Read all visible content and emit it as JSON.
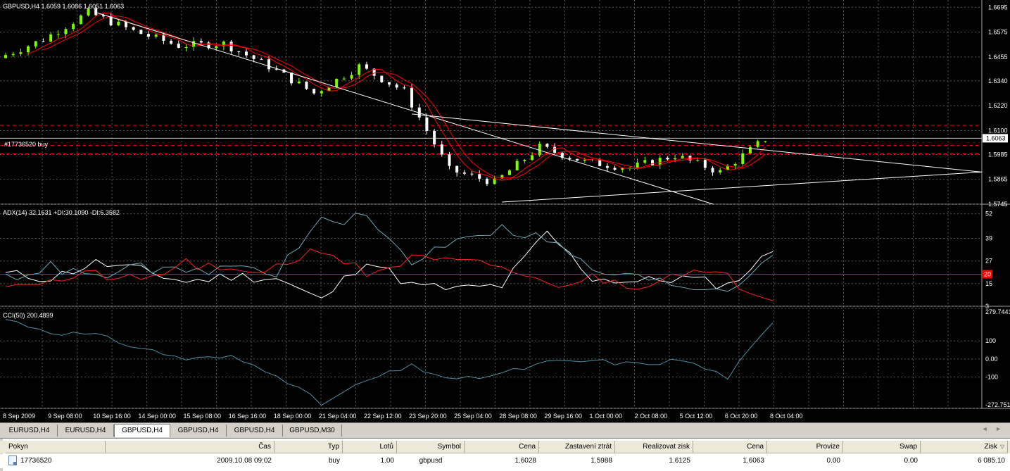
{
  "colors": {
    "background": "#000000",
    "grid": "#5a5a5a",
    "bull_candle": "#7cfc00",
    "bear_candle": "#ffffff",
    "ma": "#ff0000",
    "trendline": "#ffffff",
    "level_line": "#ff0000",
    "price_line": "#c0c0c0",
    "adx_main": "#ffffff",
    "adx_plus_di": "#6fa8b4",
    "adx_minus_di": "#ff2020",
    "cci": "#4f8ea0"
  },
  "main_panel": {
    "header": "GBPUSD,H4  1.6059 1.6086 1.6051 1.6063",
    "order_label": "#17736520 buy",
    "current_price": "1.6063",
    "price_axis": [
      "1.6695",
      "1.6575",
      "1.6455",
      "1.6340",
      "1.6220",
      "1.6100",
      "1.5985",
      "1.5865",
      "1.5745"
    ]
  },
  "adx_panel": {
    "header": "ADX(14) 32.1631 +DI:30.1090 -DI:6.3582",
    "axis": [
      "52",
      "39",
      "27",
      "15",
      "3"
    ],
    "level_marker": "20"
  },
  "cci_panel": {
    "header": "CCI(50) 200.4899",
    "axis": [
      "279.7441",
      "100",
      "0.00",
      "-100",
      "-272.751"
    ]
  },
  "time_axis": [
    "8 Sep 2009",
    "9 Sep 08:00",
    "10 Sep 16:00",
    "14 Sep 00:00",
    "15 Sep 08:00",
    "16 Sep 16:00",
    "18 Sep 00:00",
    "21 Sep 04:00",
    "22 Sep 12:00",
    "23 Sep 20:00",
    "25 Sep 04:00",
    "28 Sep 08:00",
    "29 Sep 16:00",
    "1 Oct 00:00",
    "2 Oct 08:00",
    "5 Oct 12:00",
    "6 Oct 20:00",
    "8 Oct 04:00"
  ],
  "tabs": [
    {
      "label": "EURUSD,H4",
      "active": false
    },
    {
      "label": "EURUSD,H4",
      "active": false
    },
    {
      "label": "GBPUSD,H4",
      "active": true
    },
    {
      "label": "GBPUSD,H4",
      "active": false
    },
    {
      "label": "GBPUSD,H4",
      "active": false
    },
    {
      "label": "GBPUSD,M30",
      "active": false
    }
  ],
  "tab_scroll": "◄ ►",
  "terminal": {
    "columns": [
      "Pokyn",
      "Čas",
      "Typ",
      "Lotů",
      "Symbol",
      "Cena",
      "Zastavení ztrát",
      "Realizovat zisk",
      "Cena",
      "Provize",
      "Swap",
      "Zisk"
    ],
    "sort_indicator": "▽",
    "rows": [
      [
        "17736520",
        "2009.10.08 09:02",
        "buy",
        "1.00",
        "gbpusd",
        "1.6028",
        "1.5988",
        "1.6125",
        "1.6063",
        "0.00",
        "0.00",
        "6 085.10"
      ]
    ]
  },
  "chart_data": [
    {
      "type": "candlestick",
      "title": "GBPUSD,H4",
      "x": [
        "8 Sep 2009",
        "9 Sep 08:00",
        "10 Sep 16:00",
        "14 Sep 00:00",
        "15 Sep 08:00",
        "16 Sep 16:00",
        "18 Sep 00:00",
        "21 Sep 04:00",
        "22 Sep 12:00",
        "23 Sep 20:00",
        "25 Sep 04:00",
        "28 Sep 08:00",
        "29 Sep 16:00",
        "1 Oct 00:00",
        "2 Oct 08:00",
        "5 Oct 12:00",
        "6 Oct 20:00",
        "8 Oct 04:00"
      ],
      "close": [
        1.645,
        1.654,
        1.667,
        1.658,
        1.651,
        1.652,
        1.641,
        1.628,
        1.641,
        1.629,
        1.591,
        1.585,
        1.602,
        1.595,
        1.592,
        1.598,
        1.59,
        1.606
      ],
      "ylim": [
        1.5745,
        1.673
      ],
      "horizontal_levels": [
        1.6125,
        1.6063,
        1.6028,
        1.5988
      ],
      "trendlines": [
        {
          "from": [
            "10 Sep 16:00",
            1.667
          ],
          "to": [
            "28 Sep 08:00",
            1.5745
          ]
        },
        {
          "from": [
            "23 Sep 20:00",
            1.618
          ],
          "to": [
            "8 Oct 04:00",
            1.59
          ]
        },
        {
          "from": [
            "28 Sep 08:00",
            1.5755
          ],
          "to": [
            "8 Oct 04:00",
            1.59
          ]
        }
      ]
    },
    {
      "type": "line",
      "title": "ADX(14)",
      "x": [
        "8 Sep 2009",
        "9 Sep 08:00",
        "10 Sep 16:00",
        "14 Sep 00:00",
        "15 Sep 08:00",
        "16 Sep 16:00",
        "18 Sep 00:00",
        "21 Sep 04:00",
        "22 Sep 12:00",
        "23 Sep 20:00",
        "25 Sep 04:00",
        "28 Sep 08:00",
        "29 Sep 16:00",
        "1 Oct 00:00",
        "2 Oct 08:00",
        "5 Oct 12:00",
        "6 Oct 20:00",
        "8 Oct 04:00"
      ],
      "series": [
        {
          "name": "ADX",
          "values": [
            20,
            18,
            26,
            22,
            16,
            19,
            18,
            6,
            28,
            14,
            12,
            14,
            42,
            18,
            16,
            18,
            14,
            32
          ]
        },
        {
          "name": "+DI",
          "values": [
            18,
            24,
            18,
            24,
            20,
            24,
            21,
            48,
            50,
            26,
            40,
            44,
            39,
            22,
            18,
            14,
            12,
            30
          ]
        },
        {
          "name": "-DI",
          "values": [
            16,
            16,
            20,
            16,
            26,
            20,
            24,
            34,
            20,
            28,
            26,
            24,
            14,
            18,
            14,
            22,
            18,
            6
          ]
        }
      ],
      "level": 20,
      "ylim": [
        3,
        56
      ]
    },
    {
      "type": "line",
      "title": "CCI(50)",
      "x": [
        "8 Sep 2009",
        "9 Sep 08:00",
        "10 Sep 16:00",
        "14 Sep 00:00",
        "15 Sep 08:00",
        "16 Sep 16:00",
        "18 Sep 00:00",
        "21 Sep 04:00",
        "22 Sep 12:00",
        "23 Sep 20:00",
        "25 Sep 04:00",
        "28 Sep 08:00",
        "29 Sep 16:00",
        "1 Oct 00:00",
        "2 Oct 08:00",
        "5 Oct 12:00",
        "6 Oct 20:00",
        "8 Oct 04:00"
      ],
      "series": [
        {
          "name": "CCI",
          "values": [
            220,
            150,
            130,
            60,
            0,
            10,
            -80,
            -250,
            -120,
            -40,
            -120,
            -80,
            -20,
            -10,
            -30,
            -5,
            -100,
            200
          ]
        }
      ],
      "ylim": [
        -272.751,
        279.7441
      ]
    }
  ]
}
